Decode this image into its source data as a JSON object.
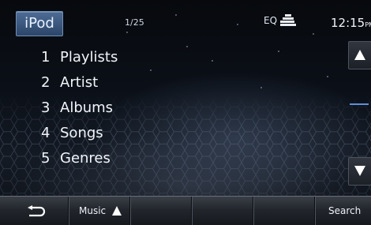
{
  "header": {
    "source_label": "iPod",
    "track_counter": "1/25",
    "eq_label": "EQ",
    "eq_icon": "eq-bars-icon",
    "time": "12:15",
    "time_suffix": "PM"
  },
  "menu": {
    "items": [
      {
        "number": "1",
        "label": "Playlists"
      },
      {
        "number": "2",
        "label": "Artist"
      },
      {
        "number": "3",
        "label": "Albums"
      },
      {
        "number": "4",
        "label": "Songs"
      },
      {
        "number": "5",
        "label": "Genres"
      }
    ]
  },
  "scroll": {
    "up_icon": "triangle-up-icon",
    "down_icon": "triangle-down-icon"
  },
  "footer": {
    "back_icon": "return-arrow-icon",
    "music_label": "Music",
    "music_icon": "triangle-up-icon",
    "search_label": "Search"
  },
  "colors": {
    "accent": "#5f8fd6",
    "source_button": "#3c5a82"
  }
}
